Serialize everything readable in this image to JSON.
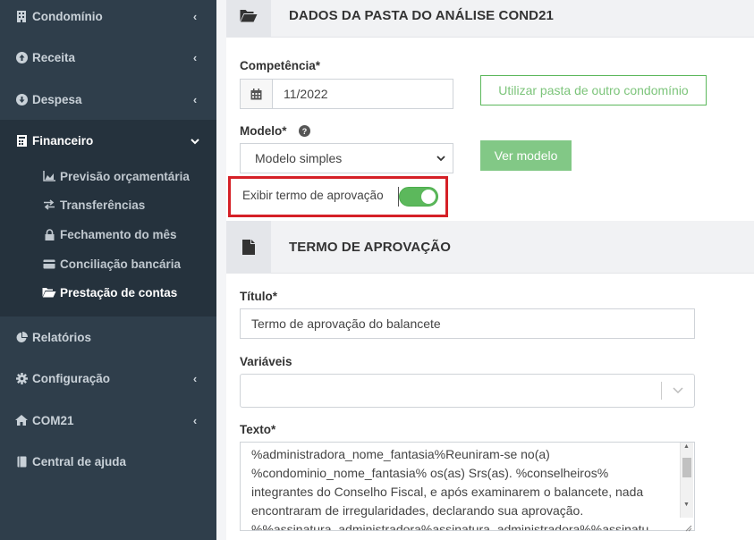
{
  "sidebar": {
    "items": [
      {
        "label": "Condomínio",
        "icon": "building-icon"
      },
      {
        "label": "Receita",
        "icon": "arrow-circle-up-icon"
      },
      {
        "label": "Despesa",
        "icon": "arrow-circle-down-icon"
      },
      {
        "label": "Financeiro",
        "icon": "calculator-icon"
      },
      {
        "label": "Relatórios",
        "icon": "pie-chart-icon"
      },
      {
        "label": "Configuração",
        "icon": "gear-icon"
      },
      {
        "label": "COM21",
        "icon": "home-icon"
      },
      {
        "label": "Central de ajuda",
        "icon": "book-icon"
      }
    ],
    "submenu": [
      {
        "label": "Previsão orçamentária",
        "icon": "area-chart-icon"
      },
      {
        "label": "Transferências",
        "icon": "exchange-icon"
      },
      {
        "label": "Fechamento do mês",
        "icon": "lock-icon"
      },
      {
        "label": "Conciliação bancária",
        "icon": "credit-card-icon"
      },
      {
        "label": "Prestação de contas",
        "icon": "folder-open-icon"
      }
    ]
  },
  "section1": {
    "title": "DADOS DA PASTA DO ANÁLISE COND21",
    "competencia_label": "Competência*",
    "competencia_value": "11/2022",
    "other_condo_button": "Utilizar pasta de outro condomínio",
    "modelo_label": "Modelo*",
    "modelo_value": "Modelo simples",
    "ver_modelo_button": "Ver modelo",
    "toggle_label": "Exibir termo de aprovação",
    "toggle_on": true
  },
  "section2": {
    "title": "TERMO DE APROVAÇÃO",
    "titulo_label": "Título*",
    "titulo_value": "Termo de aprovação do balancete",
    "variaveis_label": "Variáveis",
    "texto_label": "Texto*",
    "texto_lines": [
      "%administradora_nome_fantasia%Reuniram-se no(a)",
      "%condominio_nome_fantasia% os(as) Srs(as). %conselheiros%",
      "integrantes do Conselho Fiscal, e após examinarem o balancete, nada",
      "encontraram de irregularidades, declarando sua aprovação.",
      "%%assinatura_administradora%assinatura_administradora%%assinatu"
    ]
  },
  "colors": {
    "sidebar_bg": "#2f3e4b",
    "accent_green": "#5cb85c",
    "highlight_red": "#d52027"
  }
}
